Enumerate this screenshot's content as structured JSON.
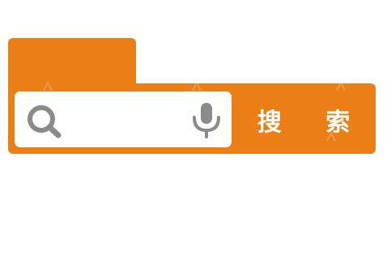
{
  "colors": {
    "brand_orange": "#EB7F16",
    "icon_gray": "#8A8A8A",
    "box_white": "#FFFFFF"
  },
  "search": {
    "value": "",
    "placeholder": "",
    "button_label": "搜 索",
    "icons": {
      "left": "search-icon",
      "right": "microphone-icon"
    }
  }
}
